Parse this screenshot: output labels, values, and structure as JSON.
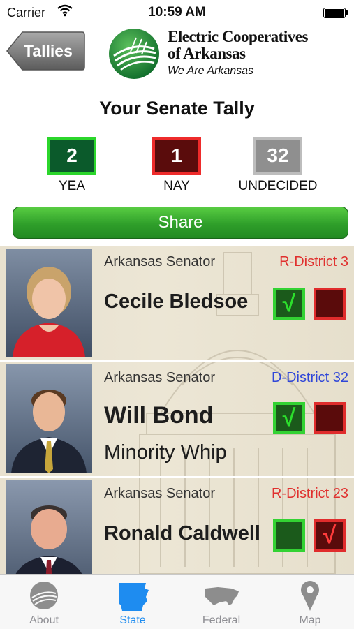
{
  "status_bar": {
    "carrier": "Carrier",
    "time": "10:59 AM"
  },
  "header": {
    "back_label": "Tallies",
    "brand_line1": "Electric Cooperatives",
    "brand_line2": "of Arkansas",
    "tagline": "We Are Arkansas"
  },
  "title": "Your Senate Tally",
  "tallies": {
    "yea": {
      "count": "2",
      "label": "YEA"
    },
    "nay": {
      "count": "1",
      "label": "NAY"
    },
    "undecided": {
      "count": "32",
      "label": "UNDECIDED"
    }
  },
  "share_label": "Share",
  "senators": [
    {
      "subtitle": "Arkansas Senator",
      "district": "R-District 3",
      "party_color": "#e0302e",
      "name": "Cecile Bledsoe",
      "role": "",
      "yea": "√",
      "nay": ""
    },
    {
      "subtitle": "Arkansas Senator",
      "district": "D-District 32",
      "party_color": "#2f46d8",
      "name": "Will Bond",
      "role": "Minority Whip",
      "yea": "√",
      "nay": ""
    },
    {
      "subtitle": "Arkansas Senator",
      "district": "R-District 23",
      "party_color": "#e0302e",
      "name": "Ronald Caldwell",
      "role": "",
      "yea": "",
      "nay": "√"
    }
  ],
  "tabs": [
    {
      "label": "About",
      "icon": "co-op-logo-icon",
      "active": false
    },
    {
      "label": "State",
      "icon": "arkansas-map-icon",
      "active": true
    },
    {
      "label": "Federal",
      "icon": "usa-map-icon",
      "active": false
    },
    {
      "label": "Map",
      "icon": "map-pin-icon",
      "active": false
    }
  ],
  "colors": {
    "yea": "#2bd62b",
    "nay": "#ee2b2b",
    "undecided": "#8f8f8f",
    "share": "#2f9f2a",
    "active_tab": "#1e8cf0"
  }
}
